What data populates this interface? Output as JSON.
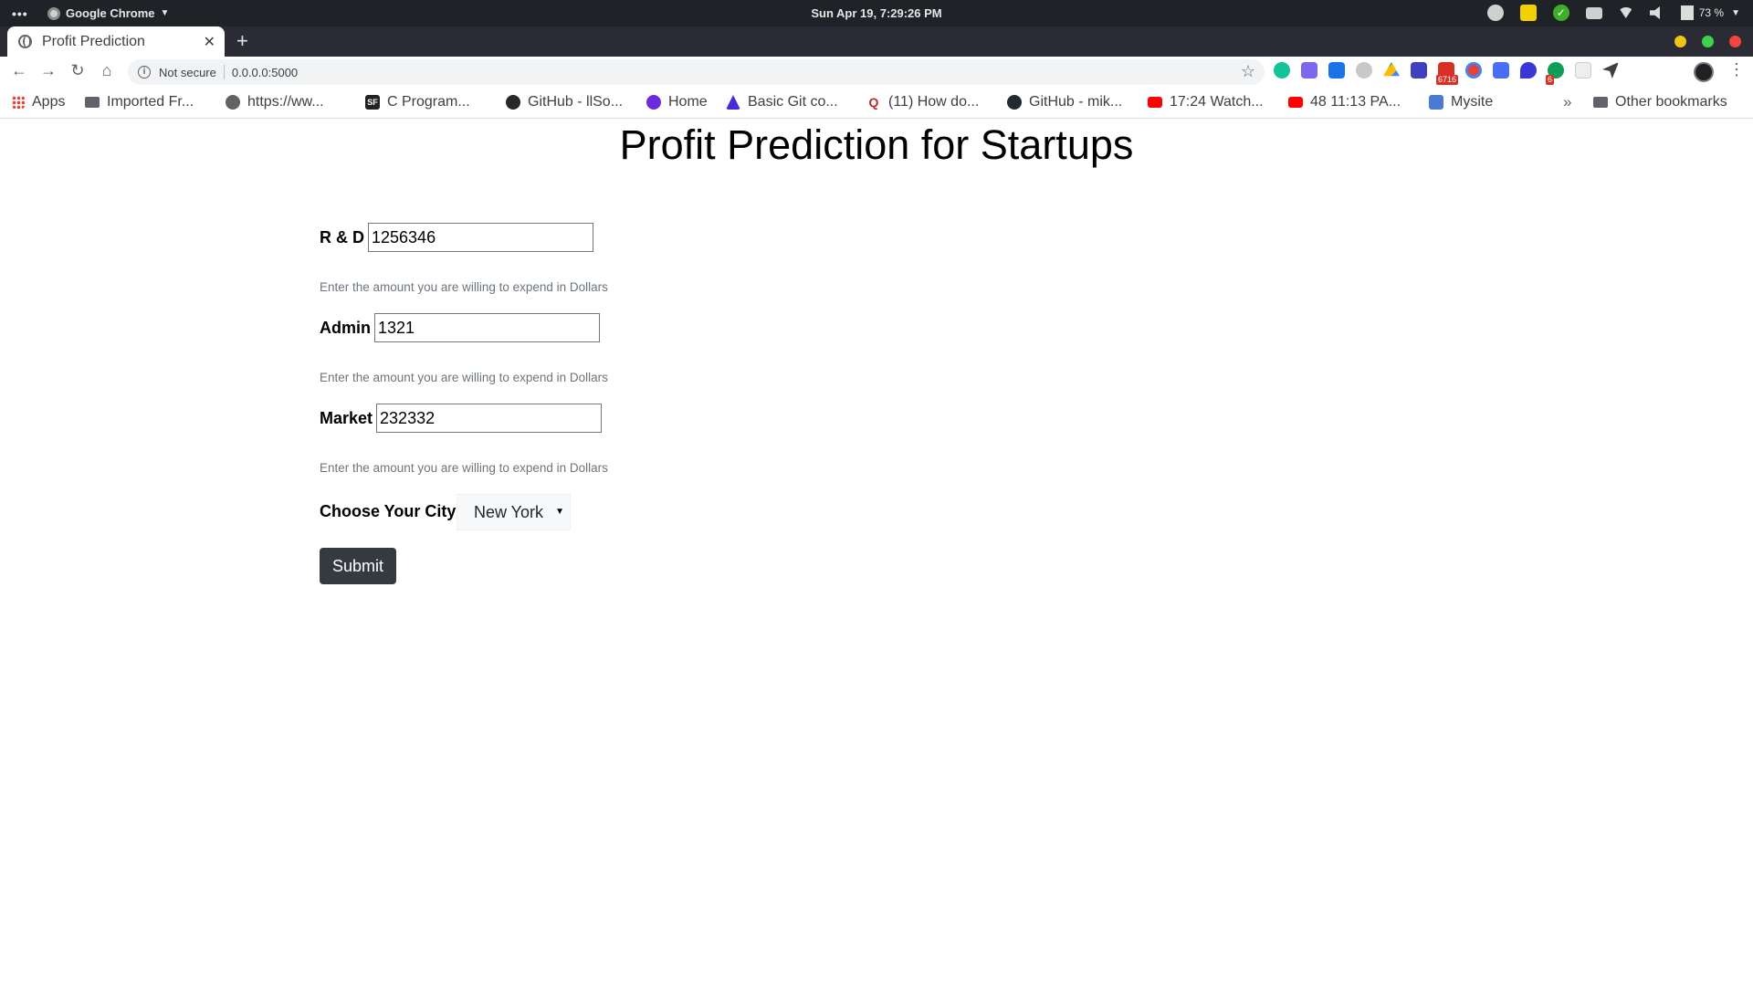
{
  "os": {
    "app_name": "Google Chrome",
    "clock": "Sun Apr 19,  7:29:26 PM",
    "battery": "73 %"
  },
  "browser": {
    "tab_title": "Profit Prediction",
    "omnibox": {
      "security_label": "Not secure",
      "url": "0.0.0.0:5000"
    },
    "extension_badges": {
      "gmail": "6716",
      "ext_count": "6"
    },
    "bookmarks": [
      {
        "label": "Apps",
        "icon": "apps-grid-icon"
      },
      {
        "label": "Imported Fr...",
        "icon": "folder-icon"
      },
      {
        "label": "https://ww...",
        "icon": "globe-icon"
      },
      {
        "label": "C Program...",
        "icon": "sf-icon"
      },
      {
        "label": "GitHub - llSo...",
        "icon": "github-icon"
      },
      {
        "label": "Home",
        "icon": "home-favicon-icon"
      },
      {
        "label": "Basic Git co...",
        "icon": "atlassian-icon"
      },
      {
        "label": "(11) How do...",
        "icon": "quora-icon"
      },
      {
        "label": "GitHub - mik...",
        "icon": "github-icon"
      },
      {
        "label": "17:24 Watch...",
        "icon": "youtube-icon"
      },
      {
        "label": "48 11:13 PA...",
        "icon": "youtube-icon"
      },
      {
        "label": "Mysite",
        "icon": "site-icon"
      }
    ],
    "other_bookmarks": "Other bookmarks"
  },
  "page": {
    "title": "Profit Prediction for Startups",
    "fields": [
      {
        "label": "R & D",
        "value": "1256346",
        "help": "Enter the amount you are willing to expend in Dollars"
      },
      {
        "label": "Admin",
        "value": "1321",
        "help": "Enter the amount you are willing to expend in Dollars"
      },
      {
        "label": "Market",
        "value": "232332",
        "help": "Enter the amount you are willing to expend in Dollars"
      }
    ],
    "city": {
      "label": "Choose Your City :",
      "selected": "New York"
    },
    "submit_label": "Submit"
  }
}
